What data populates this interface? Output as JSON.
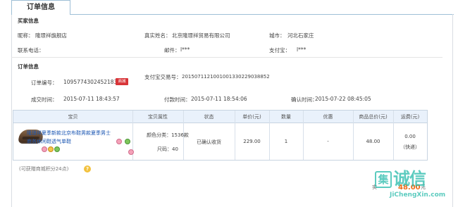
{
  "tab": {
    "label": "订单信息"
  },
  "buyer": {
    "title": "买家信息",
    "nickname_label": "昵称：",
    "nickname_value": "隆璟祥旗舰店",
    "realname_label": "真实姓名：",
    "realname_value": "北京隆璟祥贸易有限公司",
    "city_label": "城市：",
    "city_value": "河北石家庄",
    "phone_label": "联系电话：",
    "email_label": "邮件：",
    "email_value": "l***",
    "alipay_label": "支付宝：",
    "alipay_value": "l***"
  },
  "order": {
    "title": "订单信息",
    "order_no_label": "订单编号：",
    "order_no_value": "1095774302452183",
    "order_badge": "商城",
    "alipay_trade_label": "支付宝交易号：",
    "alipay_trade_value": "2015071121001001330229038852",
    "created_label": "成交时间：",
    "created_value": "2015-07-11 18:43:57",
    "paid_label": "付款时间：",
    "paid_value": "2015-07-11 18:54:06",
    "confirmed_label": "确认时间：",
    "confirmed_value": "2015-07-22 08:45:05"
  },
  "table": {
    "headers": [
      "宝贝",
      "宝贝属性",
      "状态",
      "单价(元)",
      "数量",
      "优惠",
      "商品总价(元)",
      "运费(元)"
    ],
    "row": {
      "title": "隆璟祥夏季新款北京布鞋男款夏季男士商务休闲鞋透气单鞋",
      "attribute_color": "颜色分类：1536款",
      "attribute_size": "尺码：40",
      "status": "已确认收货",
      "price": "229.00",
      "quantity": "1",
      "discount": "-",
      "total": "48.00",
      "shipping": "0.00",
      "shipping_type": "（快递）"
    }
  },
  "note": {
    "text": "(可获赠商城积分24点)"
  },
  "summary": {
    "label": "实",
    "value": "48.00",
    "suffix": "元"
  },
  "watermark": {
    "box": "集",
    "text": "诚信",
    "url": "JiChengXin.com"
  },
  "icons": {
    "help": "help-icon",
    "product_image": "shoe-product-image"
  },
  "colors": {
    "link": "#1c57b3",
    "badge": "#d83438",
    "accent": "#ef6b16",
    "table_header": "#e9f1fb",
    "watermark": "#18b6a4"
  }
}
